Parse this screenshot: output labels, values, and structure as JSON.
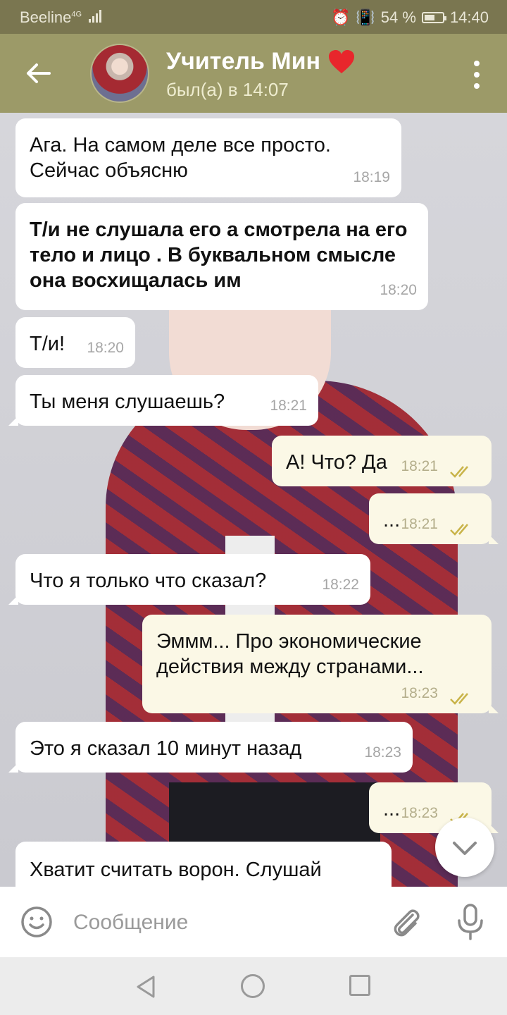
{
  "status_bar": {
    "carrier": "Beeline",
    "network": "4G",
    "battery": "54 %",
    "battery_level": 0.54,
    "time": "14:40"
  },
  "header": {
    "title": "Учитель Мин",
    "heart_emoji": "❤️",
    "subtitle": "был(а) в 14:07"
  },
  "messages": [
    {
      "dir": "in",
      "text": "Ага. На самом деле все просто. Сейчас объясню",
      "time": "18:19"
    },
    {
      "dir": "in",
      "text": "Т/и не слушала его а смотрела на его тело и лицо . В буквальном смысле она восхищалась им",
      "time": "18:20",
      "bold": true
    },
    {
      "dir": "in",
      "text": "Т/и!",
      "time": "18:20"
    },
    {
      "dir": "in",
      "text": "Ты меня слушаешь?",
      "time": "18:21"
    },
    {
      "dir": "out",
      "text": "А! Что? Да",
      "time": "18:21",
      "status": "read"
    },
    {
      "dir": "out",
      "text": "...",
      "time": "18:21",
      "status": "read"
    },
    {
      "dir": "in",
      "text": "Что я только что сказал?",
      "time": "18:22"
    },
    {
      "dir": "out",
      "text": "Эммм... Про экономические действия между странами...",
      "time": "18:23",
      "status": "read"
    },
    {
      "dir": "in",
      "text": "Это я сказал 10 минут назад",
      "time": "18:23"
    },
    {
      "dir": "out",
      "text": "...",
      "time": "18:23",
      "status": "read"
    },
    {
      "dir": "in",
      "text": "Хватит считать ворон. Слушай",
      "time": ""
    }
  ],
  "input": {
    "placeholder": "Сообщение"
  },
  "colors": {
    "header": "#9c9a68",
    "status_bar": "#7a7650",
    "incoming_bubble": "#ffffff",
    "outgoing_bubble": "#fbf8e6",
    "read_ticks": "#c9b44a"
  },
  "icons": [
    "back-arrow-icon",
    "more-vert-icon",
    "emoji-icon",
    "attach-icon",
    "mic-icon",
    "chevron-down-icon",
    "nav-back-icon",
    "nav-home-icon",
    "nav-recent-icon"
  ]
}
